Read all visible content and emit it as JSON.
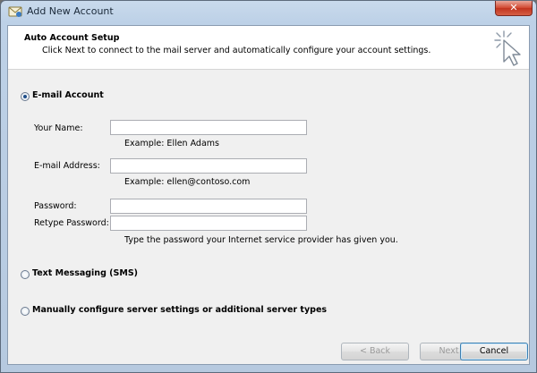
{
  "window": {
    "title": "Add New Account",
    "close_label": "✕"
  },
  "header": {
    "title": "Auto Account Setup",
    "subtitle": "Click Next to connect to the mail server and automatically configure your account settings."
  },
  "options": {
    "email_account": {
      "label": "E-mail Account",
      "selected": true
    },
    "text_messaging": {
      "label": "Text Messaging (SMS)",
      "selected": false
    },
    "manual": {
      "label": "Manually configure server settings or additional server types",
      "selected": false
    }
  },
  "fields": {
    "your_name": {
      "label": "Your Name:",
      "value": "",
      "example": "Example: Ellen Adams"
    },
    "email_address": {
      "label": "E-mail Address:",
      "value": "",
      "example": "Example: ellen@contoso.com"
    },
    "password": {
      "label": "Password:",
      "value": ""
    },
    "retype_password": {
      "label": "Retype Password:",
      "value": ""
    },
    "password_hint": "Type the password your Internet service provider has given you."
  },
  "buttons": {
    "back": "< Back",
    "next": "Next >",
    "cancel": "Cancel"
  }
}
